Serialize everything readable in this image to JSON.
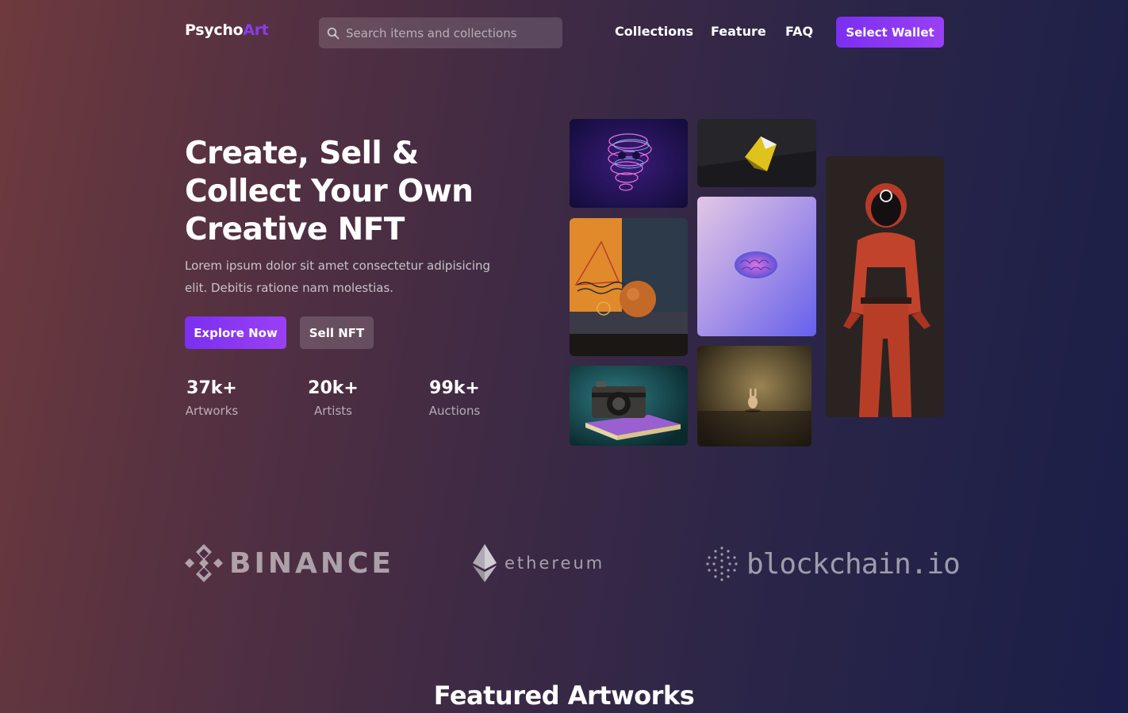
{
  "brand": {
    "name_part1": "Psycho",
    "name_part2": "Art",
    "accent_color": "#8a3bf0"
  },
  "search": {
    "placeholder": "Search items and collections",
    "icon": "search-icon"
  },
  "nav": {
    "links": [
      "Collections",
      "Feature",
      "FAQ"
    ],
    "cta": "Select Wallet"
  },
  "hero": {
    "title": "Create, Sell &\nCollect Your Own\nCreative NFT",
    "description": "Lorem ipsum dolor sit amet consectetur adipisicing elit. Debitis ratione nam molestias.",
    "primary_button": "Explore Now",
    "secondary_button": "Sell NFT"
  },
  "stats": [
    {
      "value": "37k+",
      "label": "Artworks"
    },
    {
      "value": "20k+",
      "label": "Artists"
    },
    {
      "value": "99k+",
      "label": "Auctions"
    }
  ],
  "gallery": [
    "neon-skull-artwork",
    "gold-geometric-artwork",
    "orange-sphere-artwork",
    "brain-artwork",
    "camera-book-artwork",
    "bunny-figure-artwork",
    "red-suit-figure-artwork"
  ],
  "partners": {
    "binance": "BINANCE",
    "ethereum": "ethereum",
    "blockchain": "blockchain.io"
  },
  "featured": {
    "title": "Featured Artworks"
  },
  "colors": {
    "primary": "#8a3bf0",
    "text": "#ffffff"
  }
}
